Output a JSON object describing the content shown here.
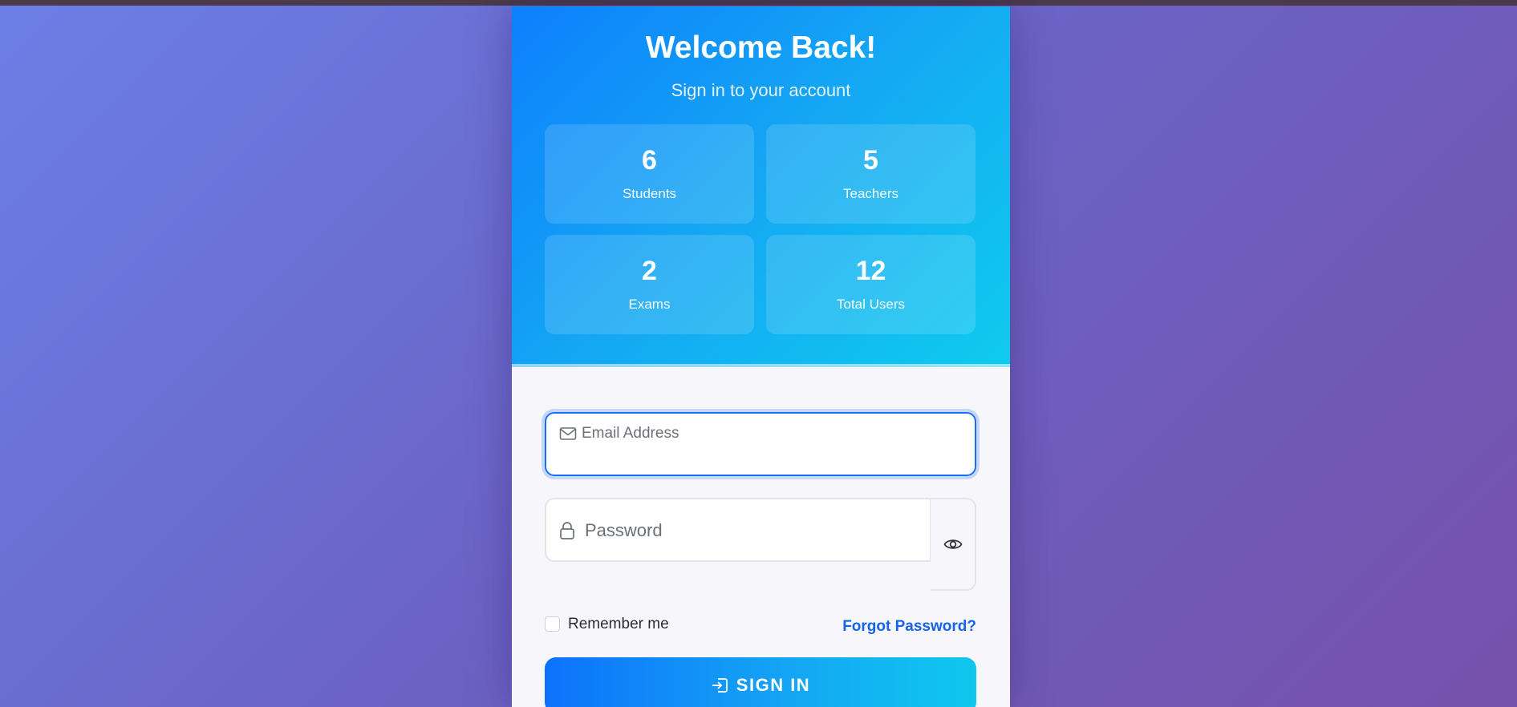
{
  "header": {
    "title": "Welcome Back!",
    "subtitle": "Sign in to your account"
  },
  "stats": [
    {
      "value": "6",
      "label": "Students"
    },
    {
      "value": "5",
      "label": "Teachers"
    },
    {
      "value": "2",
      "label": "Exams"
    },
    {
      "value": "12",
      "label": "Total Users"
    }
  ],
  "form": {
    "email": {
      "placeholder": "Email Address",
      "value": "",
      "icon": "envelope-icon"
    },
    "password": {
      "placeholder": "Password",
      "value": "",
      "icon": "lock-icon"
    },
    "toggle_icon": "eye-icon",
    "remember_label": "Remember me",
    "remember_checked": false,
    "forgot_label": "Forgot Password?",
    "submit_label": "SIGN IN",
    "submit_icon": "sign-in-icon"
  },
  "colors": {
    "accent": "#1a6ff5",
    "header_gradient_start": "#0d7ffd",
    "header_gradient_end": "#0fcbee",
    "page_background_start": "#6b7fe6",
    "page_background_end": "#7651ab",
    "link": "#1463e8"
  }
}
